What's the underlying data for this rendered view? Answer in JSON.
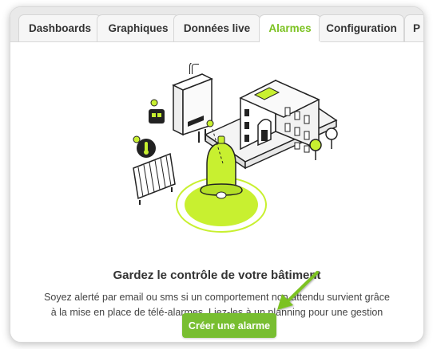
{
  "tabs": [
    {
      "label": "Dashboards",
      "active": false
    },
    {
      "label": "Graphiques",
      "active": false
    },
    {
      "label": "Données live",
      "active": false
    },
    {
      "label": "Alarmes",
      "active": true
    },
    {
      "label": "Configuration",
      "active": false
    },
    {
      "label": "P",
      "active": false
    }
  ],
  "main": {
    "headline": "Gardez le contrôle de votre bâtiment",
    "description": "Soyez alerté par email ou sms si un comportement non attendu survient grâce à la mise en place de télé-alarmes. Liez-les à un planning pour une gestion optimale.",
    "cta_label": "Créer une alarme"
  },
  "colors": {
    "accent": "#7cc221",
    "button": "#78be31",
    "illustration_highlight": "#c8f030"
  },
  "icons": [
    "bell-icon",
    "boiler-icon",
    "radiator-icon",
    "building-icon",
    "thermometer-icon",
    "tree-icon",
    "arrow-icon"
  ]
}
